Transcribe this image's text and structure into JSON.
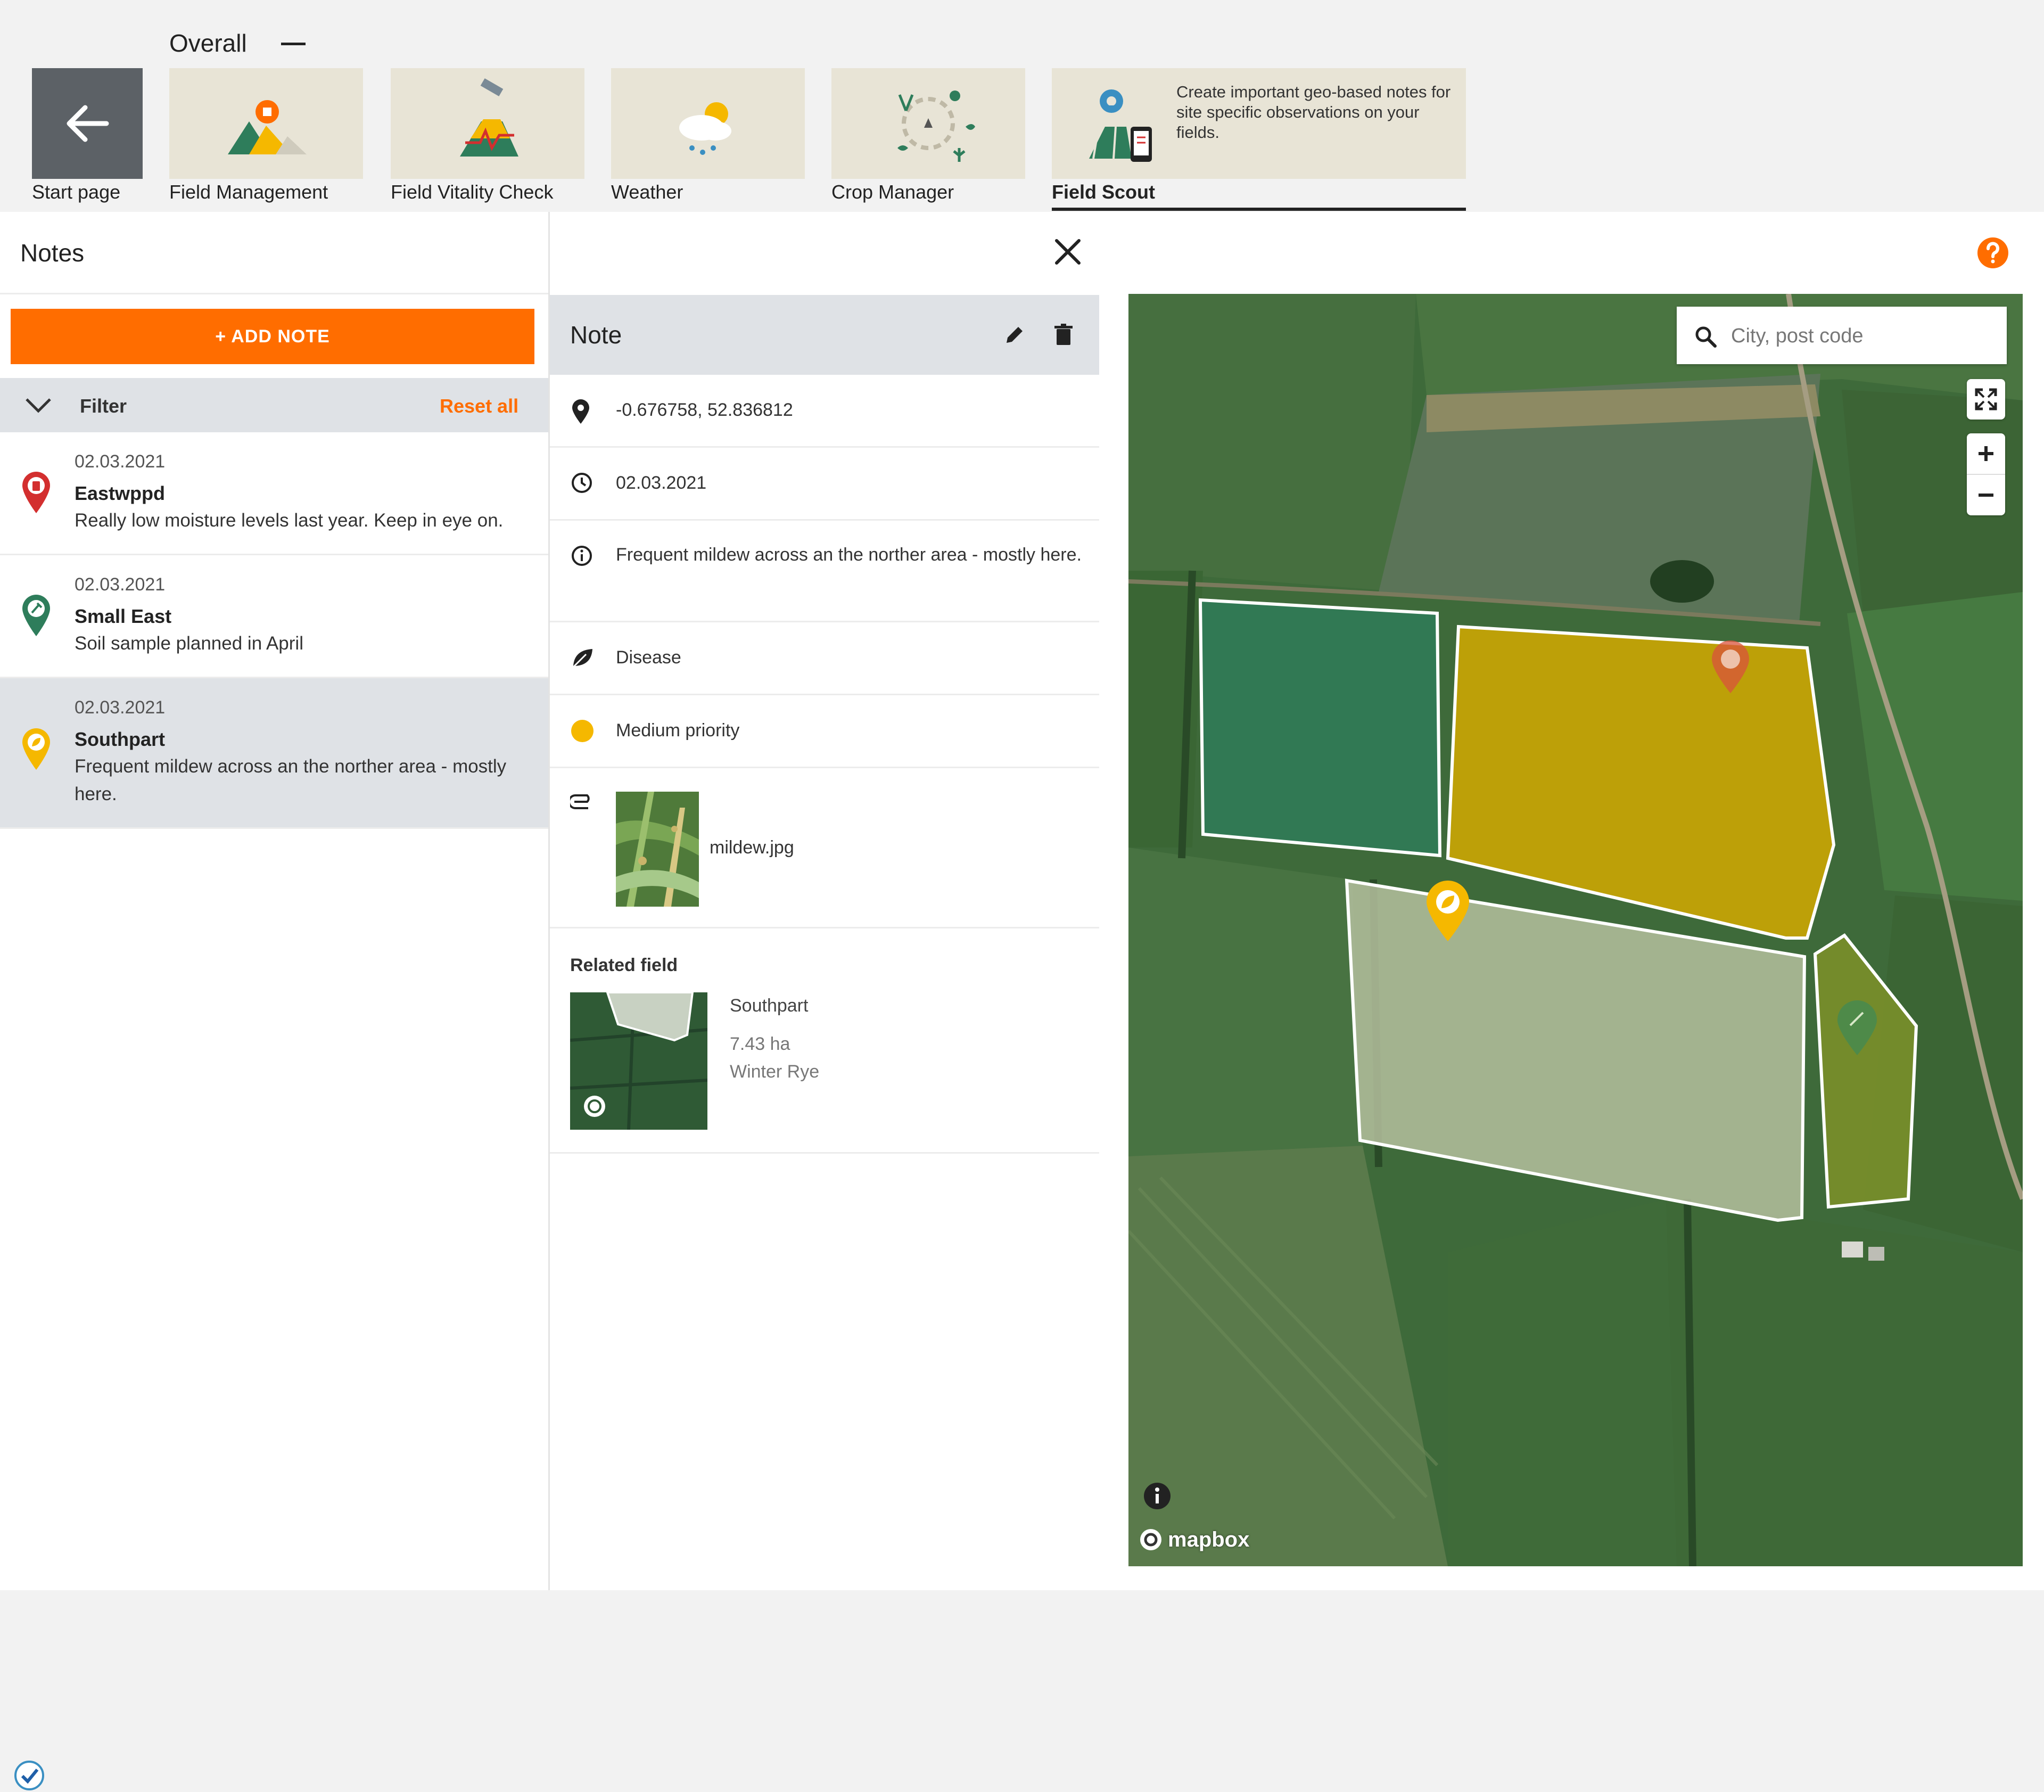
{
  "topbar": {
    "overall_label": "Overall",
    "tiles": [
      {
        "label": "Start page"
      },
      {
        "label": "Field Management"
      },
      {
        "label": "Field Vitality Check"
      },
      {
        "label": "Weather"
      },
      {
        "label": "Crop Manager"
      },
      {
        "label": "Field Scout",
        "description": "Create important geo-based notes for site specific observations on your fields.",
        "active": true
      }
    ]
  },
  "notes_panel": {
    "title": "Notes",
    "add_note_label": "+ ADD NOTE",
    "filter_label": "Filter",
    "reset_all_label": "Reset all",
    "items": [
      {
        "date": "02.03.2021",
        "name": "Eastwppd",
        "text": "Really low moisture levels last year. Keep in eye on.",
        "pin_color": "#d32f2f",
        "icon": "water-drop-icon"
      },
      {
        "date": "02.03.2021",
        "name": "Small East",
        "text": "Soil sample planned in April",
        "pin_color": "#2e7d5b",
        "icon": "soil-sample-icon"
      },
      {
        "date": "02.03.2021",
        "name": "Southpart",
        "text": "Frequent mildew across an the norther area - mostly here.",
        "pin_color": "#f5b800",
        "icon": "leaf-icon",
        "selected": true
      }
    ]
  },
  "detail_panel": {
    "title": "Note",
    "coordinates": "-0.676758, 52.836812",
    "date": "02.03.2021",
    "description": "Frequent mildew across an the norther area - mostly here.",
    "category": "Disease",
    "priority": "Medium priority",
    "priority_color": "#f5b800",
    "attachment_name": "mildew.jpg",
    "related_field": {
      "title": "Related field",
      "name": "Southpart",
      "area": "7.43 ha",
      "crop": "Winter Rye"
    }
  },
  "map": {
    "search_placeholder": "City, post code",
    "attribution": "mapbox",
    "accent_color": "#ff6d00"
  }
}
